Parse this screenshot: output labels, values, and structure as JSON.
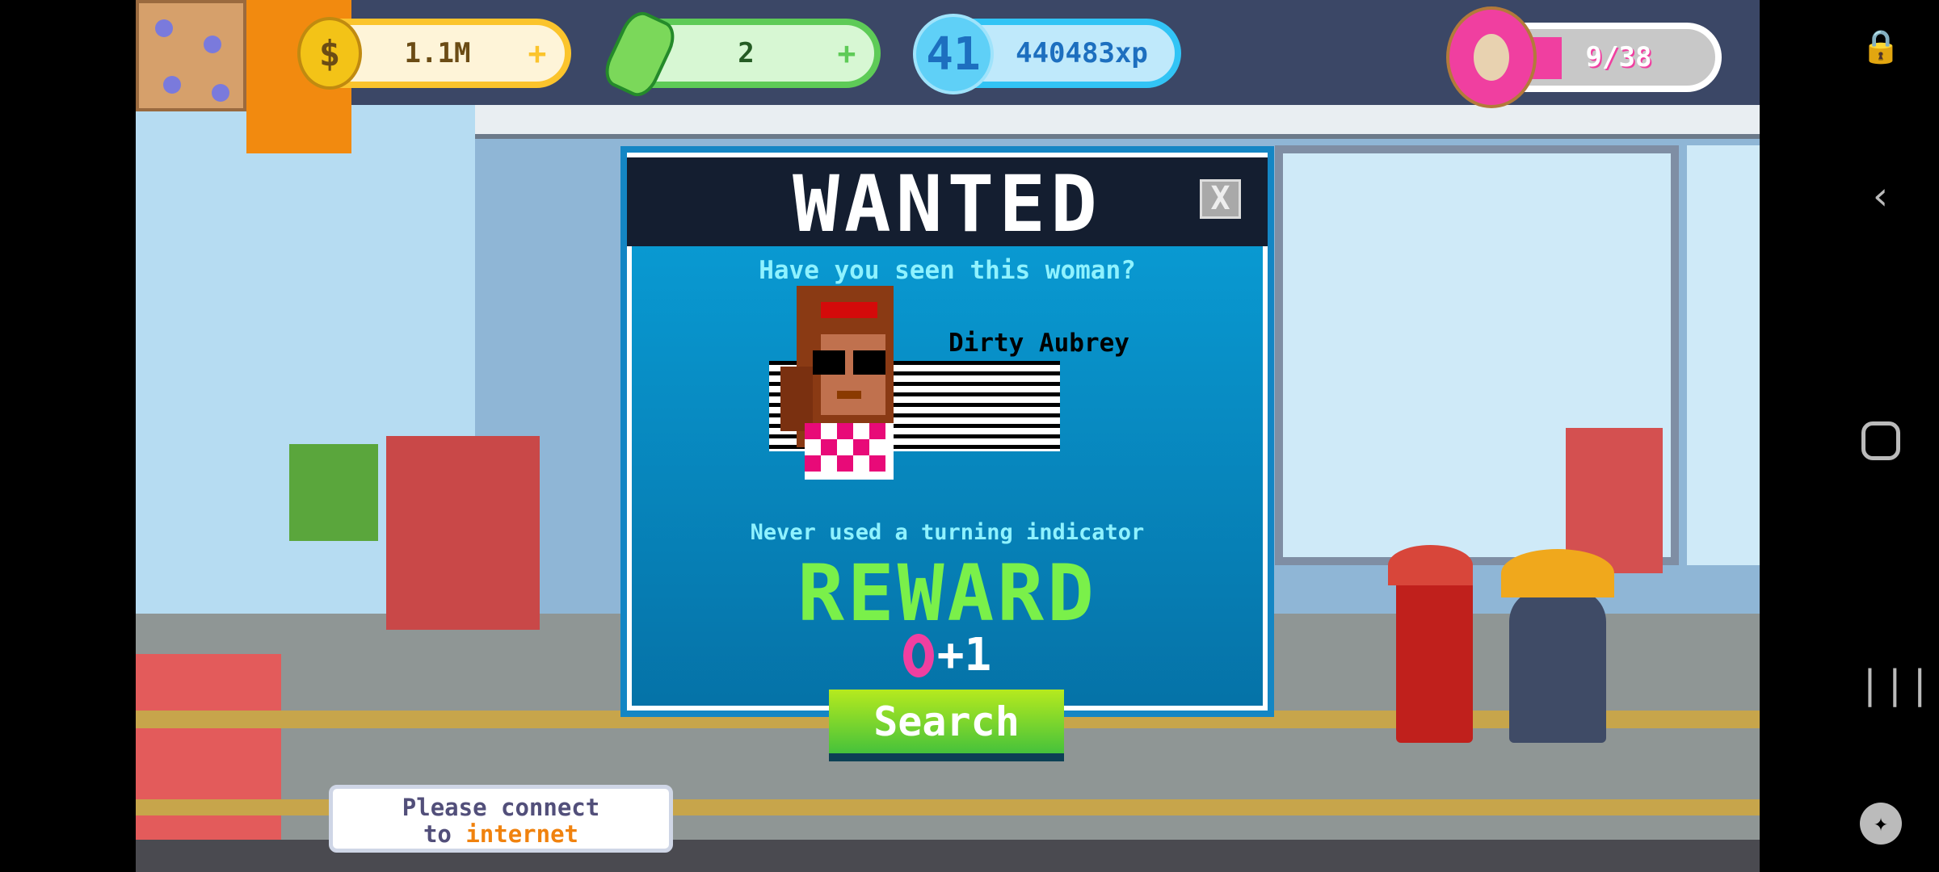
{
  "hud": {
    "coins": "1.1M",
    "cash": "2",
    "level": "41",
    "xp": "440483xp",
    "donuts": "9/38",
    "donut_progress": 0.237,
    "plus": "+"
  },
  "dialog": {
    "title": "WANTED",
    "close": "X",
    "subtitle": "Have you seen this woman?",
    "name": "Dirty Aubrey",
    "crime": "Never used a turning indicator",
    "reward_label": "REWARD",
    "reward_amount": "+1",
    "search_button": "Search"
  },
  "notice": {
    "line1": "Please connect",
    "line2_prefix": "to",
    "line2_highlight": "internet"
  },
  "colors": {
    "accent_green": "#7af04a",
    "panel_blue": "#0a8fc8",
    "donut_pink": "#f03fa0"
  },
  "system_nav": [
    "screen-lock-icon",
    "back-icon",
    "home-icon",
    "recents-icon",
    "game-controller-icon"
  ]
}
